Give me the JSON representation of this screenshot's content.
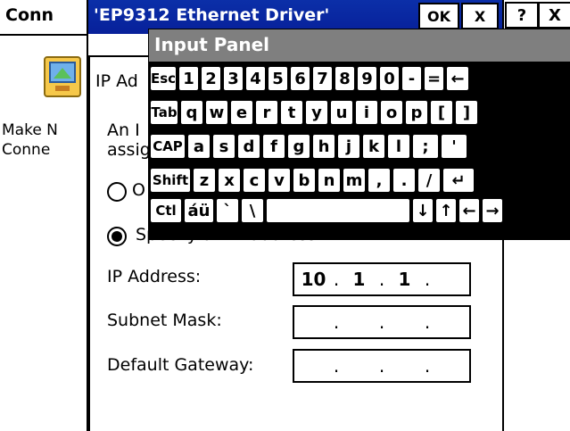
{
  "background_window": {
    "title": "Conn",
    "caption_button_help": "?",
    "caption_button_close": "X",
    "icon": "network-connection-icon",
    "label_line1": "Make N",
    "label_line2": "Conne"
  },
  "dialog": {
    "title": "'EP9312 Ethernet Driver'",
    "ok_label": "OK",
    "close_label": "X",
    "help_label": "?",
    "tab_label": "IP Ad",
    "description_line1": "An I",
    "description_line2": "assig",
    "radio_obtain_label": "O",
    "radio_specify_label": "Specify an IP address",
    "radio_selected": "specify",
    "ip_label": "IP Address:",
    "subnet_label": "Subnet Mask:",
    "gateway_label": "Default Gateway:",
    "ip_value": [
      "10",
      "1",
      "1",
      ""
    ],
    "subnet_value": [
      "",
      "",
      "",
      ""
    ],
    "gateway_value": [
      "",
      "",
      "",
      ""
    ],
    "dot": "."
  },
  "input_panel": {
    "title": "Input Panel",
    "rows": [
      [
        "Esc",
        "1",
        "2",
        "3",
        "4",
        "5",
        "6",
        "7",
        "8",
        "9",
        "0",
        "-",
        "=",
        "←"
      ],
      [
        "Tab",
        "q",
        "w",
        "e",
        "r",
        "t",
        "y",
        "u",
        "i",
        "o",
        "p",
        "[",
        "]"
      ],
      [
        "CAP",
        "a",
        "s",
        "d",
        "f",
        "g",
        "h",
        "j",
        "k",
        "l",
        ";",
        "'"
      ],
      [
        "Shift",
        "z",
        "x",
        "c",
        "v",
        "b",
        "n",
        "m",
        ",",
        ".",
        "/",
        "↵"
      ],
      [
        "Ctl",
        "áü",
        "`",
        "\\",
        " ",
        "↓",
        "↑",
        "←",
        "→"
      ]
    ]
  },
  "colors": {
    "dialog_title_bg": "#0b2fa8",
    "panel_title_bg": "#7f7f7f"
  }
}
